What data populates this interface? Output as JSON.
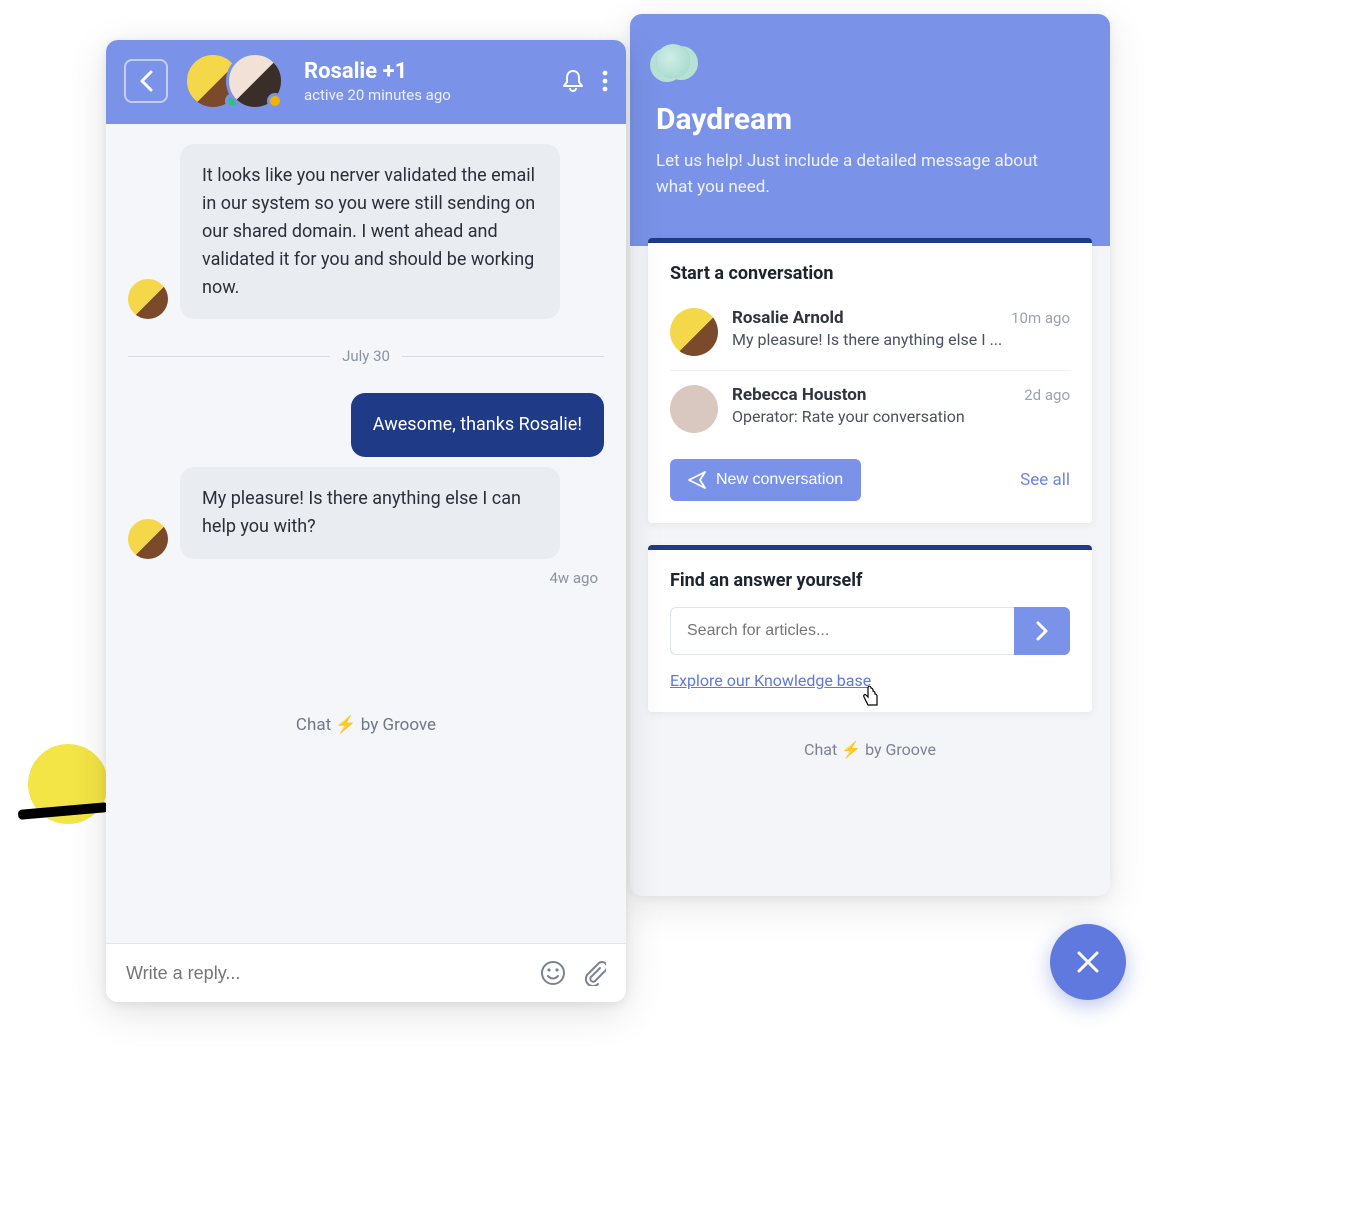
{
  "colors": {
    "primary": "#7a93e8",
    "darkblue": "#1f3b87",
    "accent": "#f5a623"
  },
  "chat": {
    "header": {
      "title": "Rosalie +1",
      "status": "active 20 minutes ago"
    },
    "messages": [
      {
        "side": "left",
        "text": "It looks like you nerver validated the email in our system so you were still sending on our shared domain. I went ahead and validated it for you and should be working now."
      }
    ],
    "date_divider": "July 30",
    "messages2": [
      {
        "side": "right",
        "text": "Awesome, thanks Rosalie!"
      },
      {
        "side": "left",
        "text": "My pleasure! Is there anything else I can help you with?"
      }
    ],
    "last_timestamp": "4w ago",
    "brand_prefix": "Chat ",
    "brand_suffix": " by Groove",
    "reply_placeholder": "Write a reply..."
  },
  "home": {
    "brand_name": "Daydream",
    "subtitle": "Let us help! Just include a detailed message about what you need.",
    "start_card": {
      "title": "Start a conversation",
      "items": [
        {
          "name": "Rosalie Arnold",
          "time": "10m ago",
          "preview": "My pleasure! Is there anything else I ..."
        },
        {
          "name": "Rebecca Houston",
          "time": "2d ago",
          "preview": "Operator:  Rate your conversation"
        }
      ],
      "new_btn": "New conversation",
      "see_all": "See all"
    },
    "answer_card": {
      "title": "Find an answer yourself",
      "search_placeholder": "Search for articles...",
      "kb_link": "Explore our Knowledge base"
    },
    "brand_prefix": "Chat ",
    "brand_suffix": " by Groove"
  }
}
